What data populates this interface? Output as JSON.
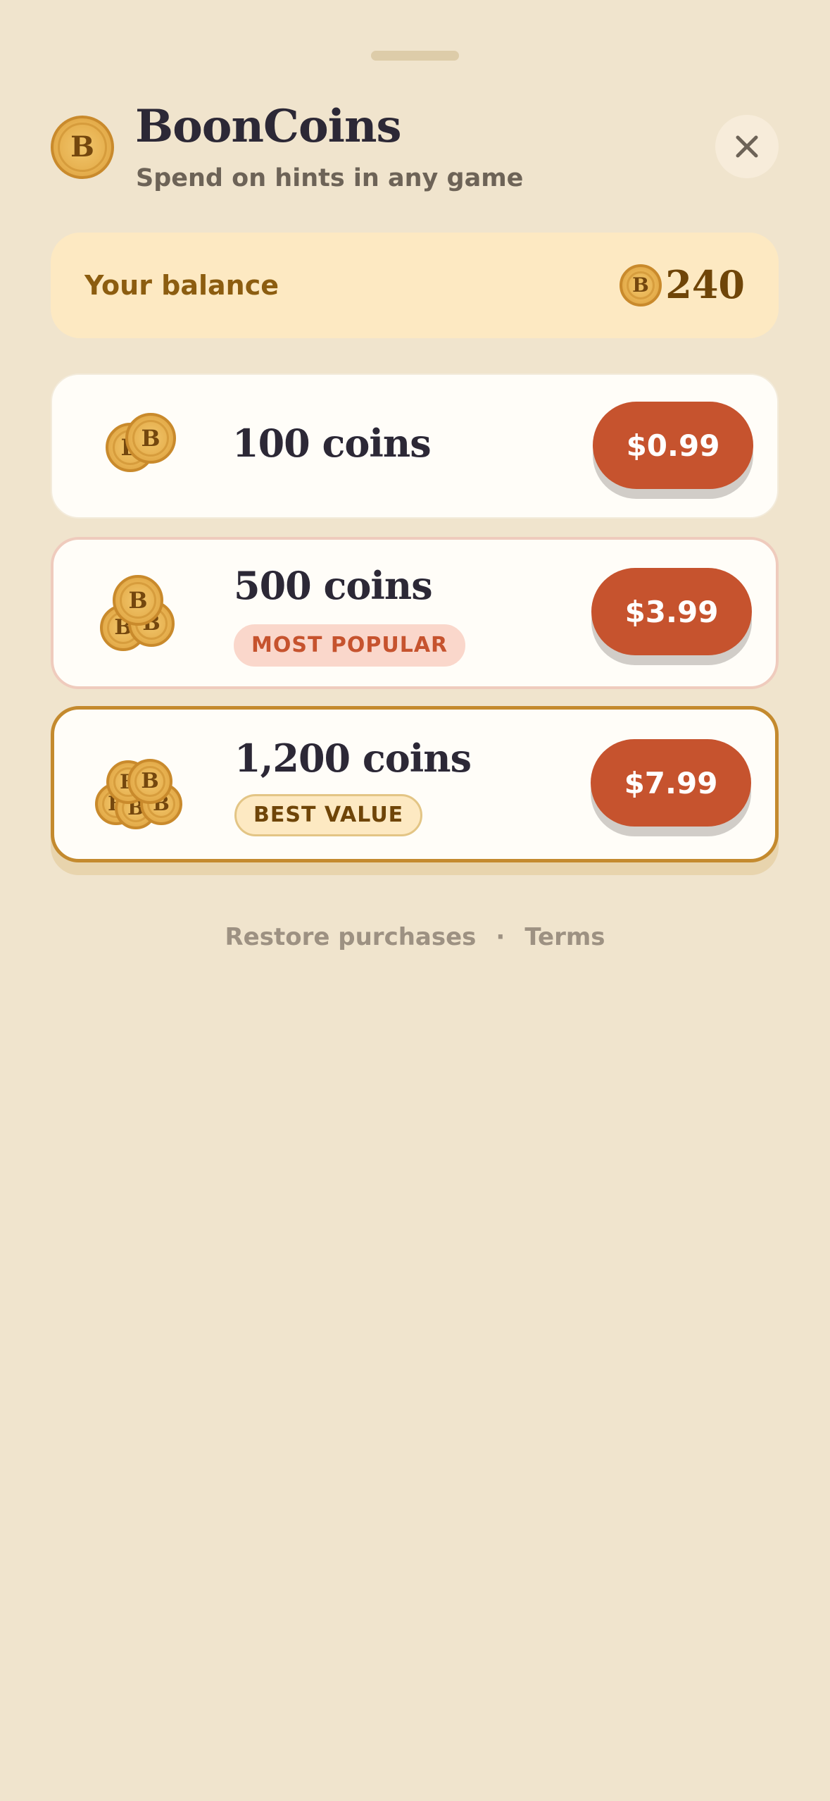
{
  "header": {
    "title": "BoonCoins",
    "subtitle": "Spend on hints in any game",
    "logo_icon": "coin-icon",
    "coin_letter": "B",
    "close_icon": "close-icon"
  },
  "balance": {
    "label": "Your balance",
    "amount": "240"
  },
  "packs": [
    {
      "amount": "100 coins",
      "price": "$0.99",
      "badge": ""
    },
    {
      "amount": "500 coins",
      "price": "$3.99",
      "badge": "MOST POPULAR"
    },
    {
      "amount": "1,200 coins",
      "price": "$7.99",
      "badge": "BEST VALUE"
    }
  ],
  "footer": {
    "restore": "Restore purchases",
    "separator": "·",
    "terms": "Terms"
  },
  "colors": {
    "background": "#f0e4cd",
    "accent": "#c6532e",
    "coin": "#e7b150",
    "balance_bg": "#fde9c2",
    "best_value_border": "#c48a2e"
  }
}
